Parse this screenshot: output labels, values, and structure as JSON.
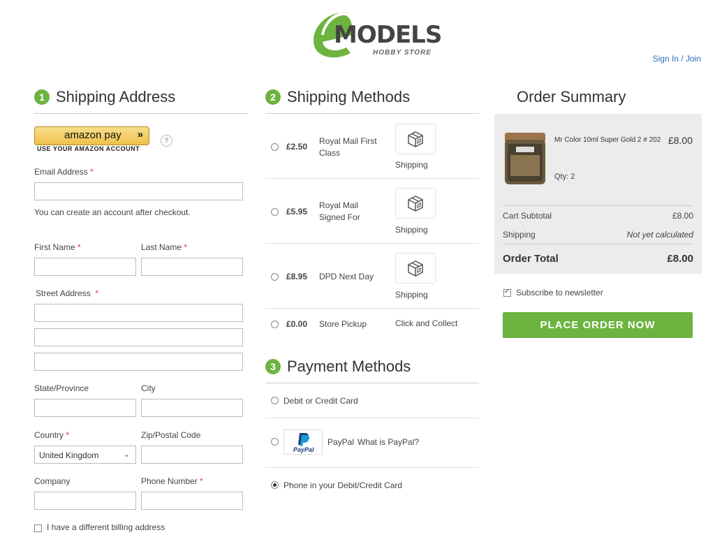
{
  "brand": {
    "logo_text": "MODELS",
    "logo_subtitle": "HOBBY STORE",
    "accent": "#6cb33f"
  },
  "header": {
    "sign_in": "Sign In",
    "separator": " / ",
    "join": "Join"
  },
  "shipping_address": {
    "step": "1",
    "title": "Shipping Address",
    "amazon_pay": {
      "label": "amazon pay",
      "arrows": "»",
      "subtitle": "USE YOUR AMAZON ACCOUNT",
      "help": "?"
    },
    "email_label": "Email Address",
    "email_value": "",
    "account_note": "You can create an account after checkout.",
    "first_name_label": "First Name",
    "last_name_label": "Last Name",
    "street_label": "Street Address",
    "state_label": "State/Province",
    "city_label": "City",
    "country_label": "Country",
    "country_value": "United Kingdom",
    "zip_label": "Zip/Postal Code",
    "company_label": "Company",
    "phone_label": "Phone Number",
    "required_mark": "*",
    "billing_checkbox": "I have a different billing address"
  },
  "shipping_methods": {
    "step": "2",
    "title": "Shipping Methods",
    "options": [
      {
        "price": "£2.50",
        "name": "Royal Mail First Class",
        "carrier": "Shipping"
      },
      {
        "price": "£5.95",
        "name": "Royal Mail Signed For",
        "carrier": "Shipping"
      },
      {
        "price": "£8.95",
        "name": "DPD Next Day",
        "carrier": "Shipping"
      },
      {
        "price": "£0.00",
        "name": "Store Pickup",
        "carrier": "Click and Collect"
      }
    ]
  },
  "payment_methods": {
    "step": "3",
    "title": "Payment Methods",
    "options": [
      {
        "label": "Debit or Credit Card",
        "selected": false
      },
      {
        "label": "PayPal",
        "link": "What is PayPal?",
        "logo_text": "PayPal",
        "selected": false
      },
      {
        "label": "Phone in your Debit/Credit Card",
        "selected": true
      }
    ]
  },
  "order_summary": {
    "title": "Order Summary",
    "product": {
      "name": "Mr Color 10ml Super Gold 2 # 202",
      "price": "£8.00",
      "qty": "Qty: 2"
    },
    "subtotal_label": "Cart Subtotal",
    "subtotal_value": "£8.00",
    "shipping_label": "Shipping",
    "shipping_value": "Not yet calculated",
    "total_label": "Order Total",
    "total_value": "£8.00",
    "newsletter": "Subscribe to newsletter",
    "place_order": "PLACE ORDER NOW"
  }
}
